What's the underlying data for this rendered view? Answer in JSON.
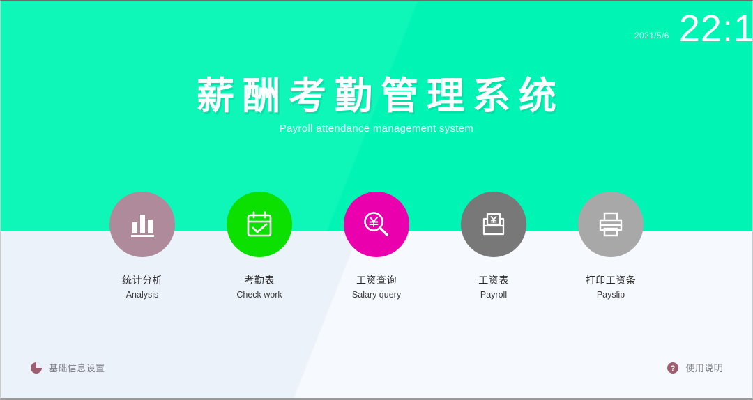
{
  "header": {
    "date": "2021/5/6",
    "time": "22:1"
  },
  "title": {
    "main": "薪酬考勤管理系统",
    "sub": "Payroll attendance management system"
  },
  "theme": {
    "banner_green": "#00F5B4",
    "page_bg": "#ECF2FA",
    "title_color": "#FFFFFF",
    "label_color": "#2B2B2B",
    "footer_text_color": "#7D7D85"
  },
  "menu": {
    "items": [
      {
        "label_cn": "统计分析",
        "label_en": "Analysis",
        "icon": "bar-chart-icon",
        "color": "#AE8A9A"
      },
      {
        "label_cn": "考勤表",
        "label_en": "Check work",
        "icon": "calendar-check-icon",
        "color": "#0BE000"
      },
      {
        "label_cn": "工资查询",
        "label_en": "Salary query",
        "icon": "yen-search-icon",
        "color": "#EB00AE"
      },
      {
        "label_cn": "工资表",
        "label_en": "Payroll",
        "icon": "pay-envelope-icon",
        "color": "#787878"
      },
      {
        "label_cn": "打印工资条",
        "label_en": "Payslip",
        "icon": "printer-icon",
        "color": "#A8A8A8"
      }
    ]
  },
  "footer": {
    "settings": {
      "label": "基础信息设置",
      "icon": "pie-clock-icon",
      "color": "#9C5E70"
    },
    "help": {
      "label": "使用说明",
      "icon": "question-circle-icon",
      "color": "#9C5E70"
    }
  }
}
